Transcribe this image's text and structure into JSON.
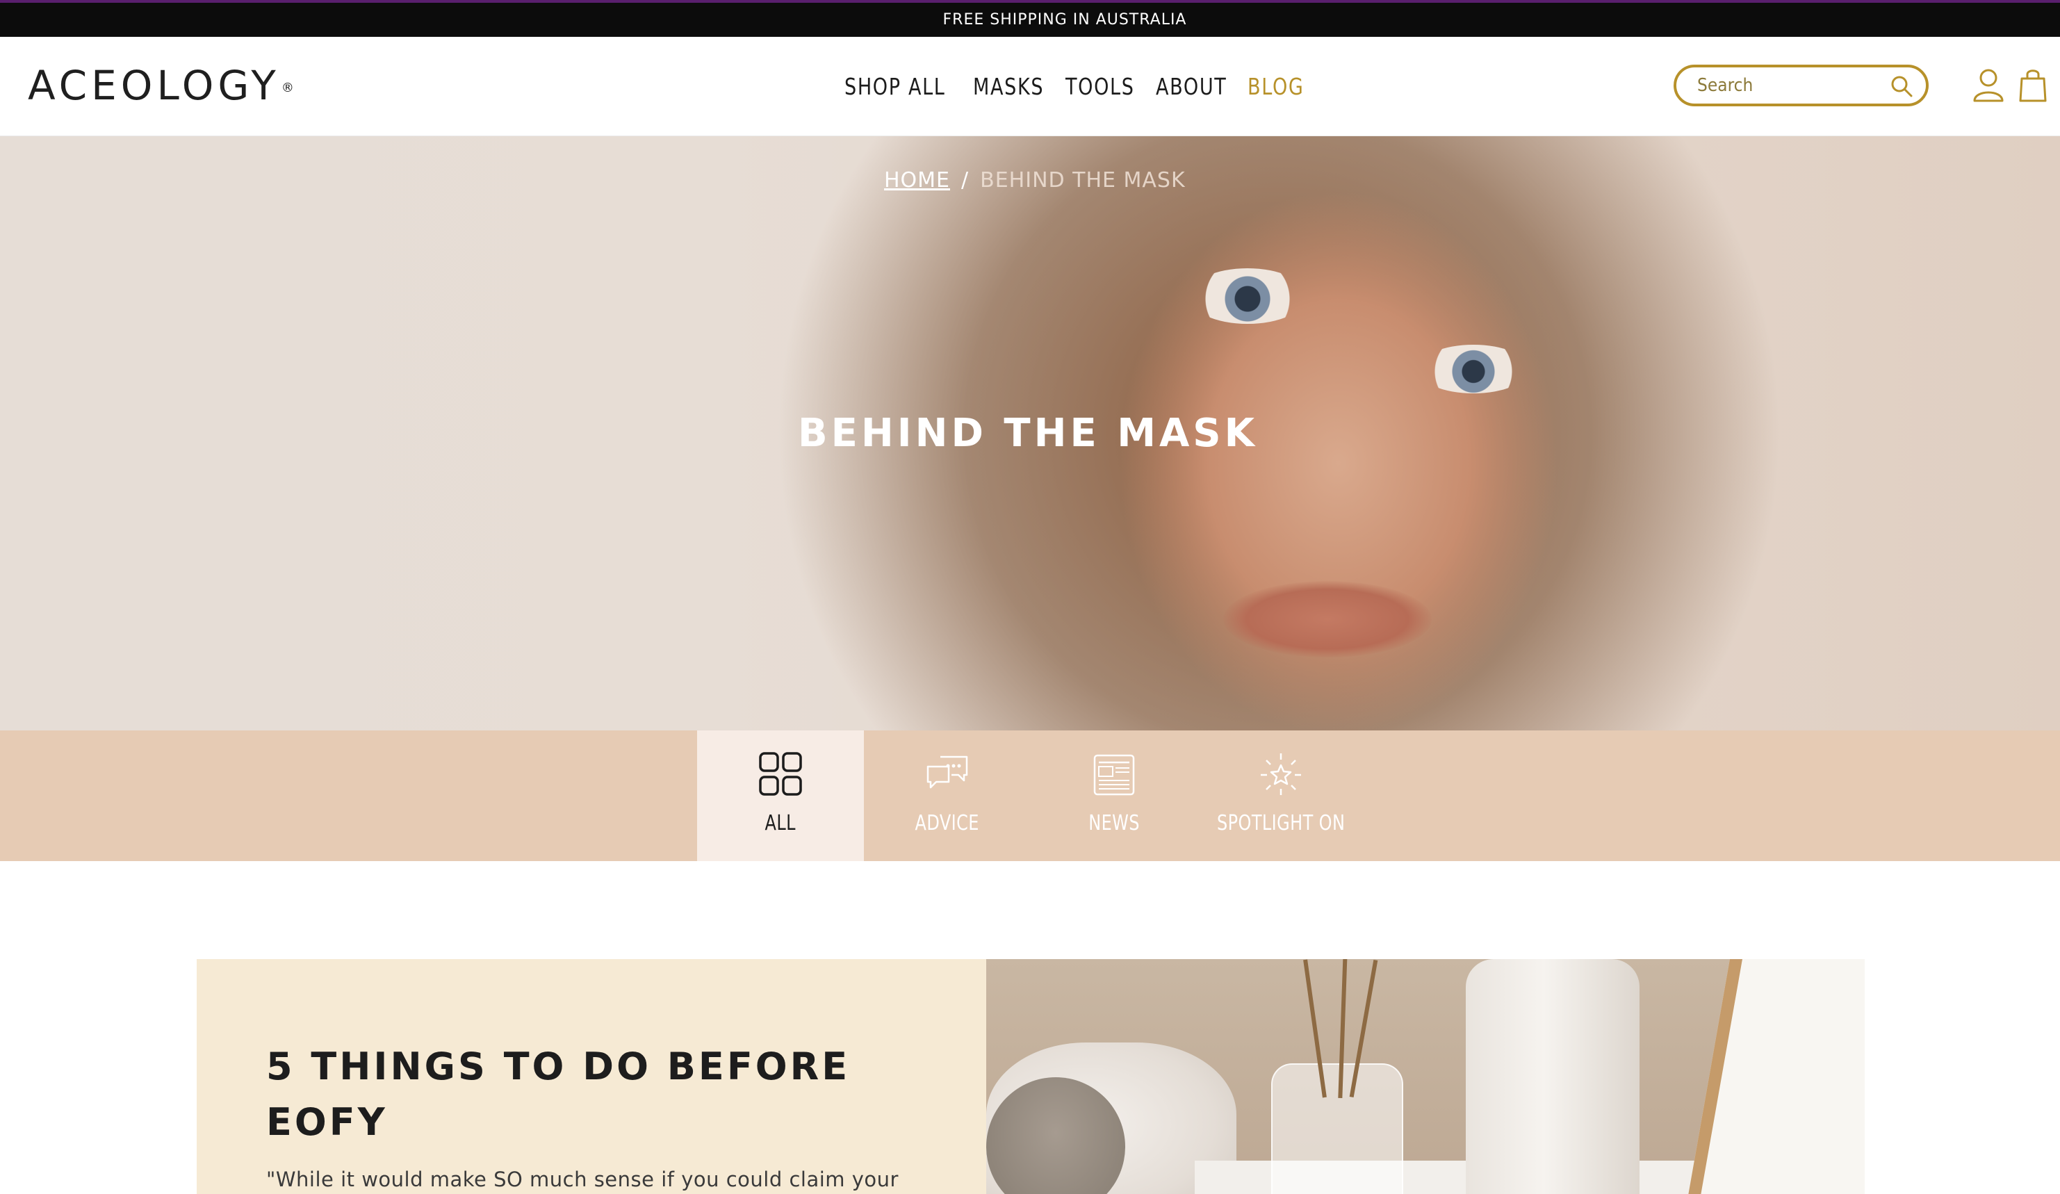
{
  "announcement": {
    "text": "FREE SHIPPING IN AUSTRALIA"
  },
  "header": {
    "logo": "ACEOLOGY",
    "logo_mark": "®",
    "nav": [
      {
        "label": "SHOP ALL",
        "active": false
      },
      {
        "label": "MASKS",
        "active": false
      },
      {
        "label": "TOOLS",
        "active": false
      },
      {
        "label": "ABOUT",
        "active": false
      },
      {
        "label": "BLOG",
        "active": true
      }
    ],
    "search": {
      "placeholder": "Search",
      "value": ""
    },
    "icons": [
      "account-icon",
      "cart-icon"
    ]
  },
  "hero": {
    "breadcrumb": {
      "home": "HOME",
      "separator": "/",
      "current": "BEHIND THE MASK"
    },
    "title": "BEHIND THE MASK"
  },
  "categories": [
    {
      "label": "ALL",
      "icon": "grid-icon",
      "active": true
    },
    {
      "label": "ADVICE",
      "icon": "chat-bubbles-icon",
      "active": false
    },
    {
      "label": "NEWS",
      "icon": "newspaper-icon",
      "active": false
    },
    {
      "label": "SPOTLIGHT ON",
      "icon": "star-burst-icon",
      "active": false
    }
  ],
  "featured_article": {
    "title": "5 THINGS TO DO BEFORE EOFY",
    "excerpt": "\"While it would make SO much sense if you could claim your"
  },
  "colors": {
    "accent_gold": "#b7912a",
    "category_bar": "#e6cbb4",
    "category_active": "#f7ece5",
    "card_bg": "#f6ead4",
    "announcement_bg": "#0c0c0c"
  }
}
